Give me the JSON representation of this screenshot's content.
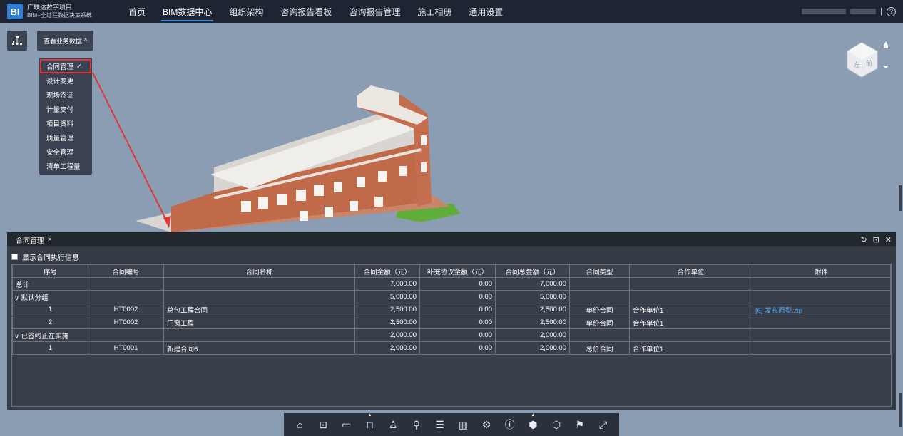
{
  "app": {
    "line1": "广联达数字项目",
    "line2": "BIM+全过程数据决策系统",
    "logo": "BI"
  },
  "nav": [
    "首页",
    "BIM数据中心",
    "组织架构",
    "咨询报告看板",
    "咨询报告管理",
    "施工相册",
    "通用设置"
  ],
  "nav_active": 1,
  "top_right": {
    "help": "?"
  },
  "toolbar_left": {
    "biz_label": "查看业务数据",
    "menu": [
      "合同管理",
      "设计变更",
      "现场签证",
      "计量支付",
      "项目资料",
      "质量管理",
      "安全管理",
      "清单工程量"
    ],
    "menu_selected": 0
  },
  "cube": {
    "face_left": "左",
    "face_front": "前"
  },
  "panel": {
    "tab_label": "合同管理",
    "checkbox_label": "显示合同执行信息",
    "columns": [
      "序号",
      "合同编号",
      "合同名称",
      "合同金额（元）",
      "补充协议金额（元）",
      "合同总金额（元）",
      "合同类型",
      "合作单位",
      "附件"
    ],
    "rows": [
      {
        "type": "total",
        "seq": "总计",
        "code": "",
        "name": "",
        "amount": "7,000.00",
        "supp": "0.00",
        "total": "7,000.00",
        "ctype": "",
        "partner": "",
        "attach": ""
      },
      {
        "type": "group",
        "seq": "默认分组",
        "code": "",
        "name": "",
        "amount": "5,000.00",
        "supp": "0.00",
        "total": "5,000.00",
        "ctype": "",
        "partner": "",
        "attach": ""
      },
      {
        "type": "item",
        "seq": "1",
        "code": "HT0002",
        "name": "总包工程合同",
        "amount": "2,500.00",
        "supp": "0.00",
        "total": "2,500.00",
        "ctype": "单价合同",
        "partner": "合作单位1",
        "attach": "[6] 发布原型.zip"
      },
      {
        "type": "item",
        "seq": "2",
        "code": "HT0002",
        "name": "门窗工程",
        "amount": "2,500.00",
        "supp": "0.00",
        "total": "2,500.00",
        "ctype": "单价合同",
        "partner": "合作单位1",
        "attach": ""
      },
      {
        "type": "group",
        "seq": "已签约正在实施",
        "code": "",
        "name": "",
        "amount": "2,000.00",
        "supp": "0.00",
        "total": "2,000.00",
        "ctype": "",
        "partner": "",
        "attach": ""
      },
      {
        "type": "item",
        "seq": "1",
        "code": "HT0001",
        "name": "新建合同6",
        "amount": "2,000.00",
        "supp": "0.00",
        "total": "2,000.00",
        "ctype": "总价合同",
        "partner": "合作单位1",
        "attach": ""
      }
    ]
  },
  "bottom_toolbar": [
    "home-icon",
    "zoom-box-icon",
    "measure-icon",
    "section-icon",
    "person-icon",
    "locate-icon",
    "list-icon",
    "chart-icon",
    "settings-icon",
    "info-icon",
    "model-icon",
    "explode-icon",
    "map-pin-icon",
    "fullscreen-icon"
  ],
  "colors": {
    "accent": "#3c8ce0",
    "arrow": "#e03636",
    "link": "#4c9ff0"
  }
}
